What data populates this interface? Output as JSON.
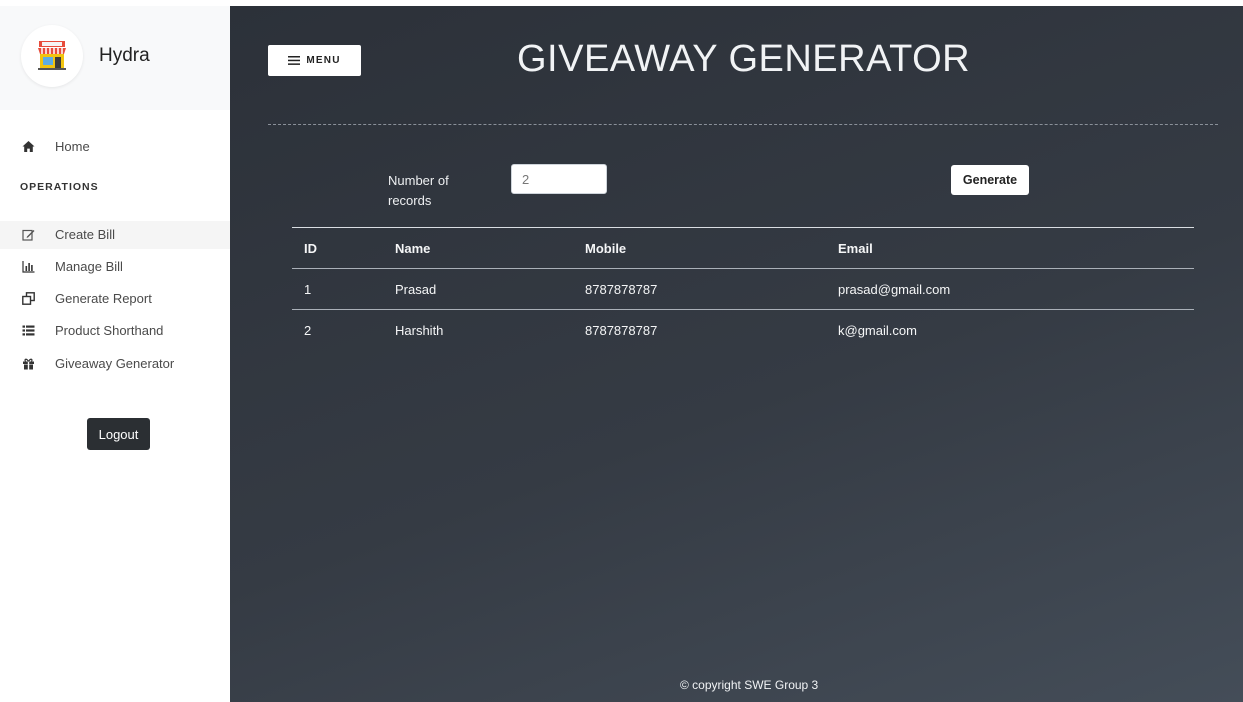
{
  "brand": {
    "name": "Hydra",
    "logo_icon": "shop-icon"
  },
  "sidebar": {
    "home": {
      "label": "Home",
      "icon": "home-icon"
    },
    "section_heading": "OPERATIONS",
    "items": [
      {
        "label": "Create Bill",
        "icon": "edit-icon"
      },
      {
        "label": "Manage Bill",
        "icon": "bar-chart-icon"
      },
      {
        "label": "Generate Report",
        "icon": "clone-icon"
      },
      {
        "label": "Product Shorthand",
        "icon": "list-icon"
      },
      {
        "label": "Giveaway Generator",
        "icon": "gift-icon"
      }
    ],
    "logout_label": "Logout"
  },
  "header": {
    "menu_label": "MENU",
    "title": "GIVEAWAY GENERATOR"
  },
  "form": {
    "count_label": "Number of records",
    "count_value": "2",
    "generate_label": "Generate"
  },
  "table": {
    "columns": [
      "ID",
      "Name",
      "Mobile",
      "Email"
    ],
    "rows": [
      [
        "1",
        "Prasad",
        "8787878787",
        "prasad@gmail.com"
      ],
      [
        "2",
        "Harshith",
        "8787878787",
        "k@gmail.com"
      ]
    ]
  },
  "footer": {
    "text": "© copyright SWE Group 3"
  },
  "colors": {
    "main_bg": "#2c3139",
    "sidebar_bg": "#ffffff",
    "logout_bg": "#2b2f33"
  }
}
